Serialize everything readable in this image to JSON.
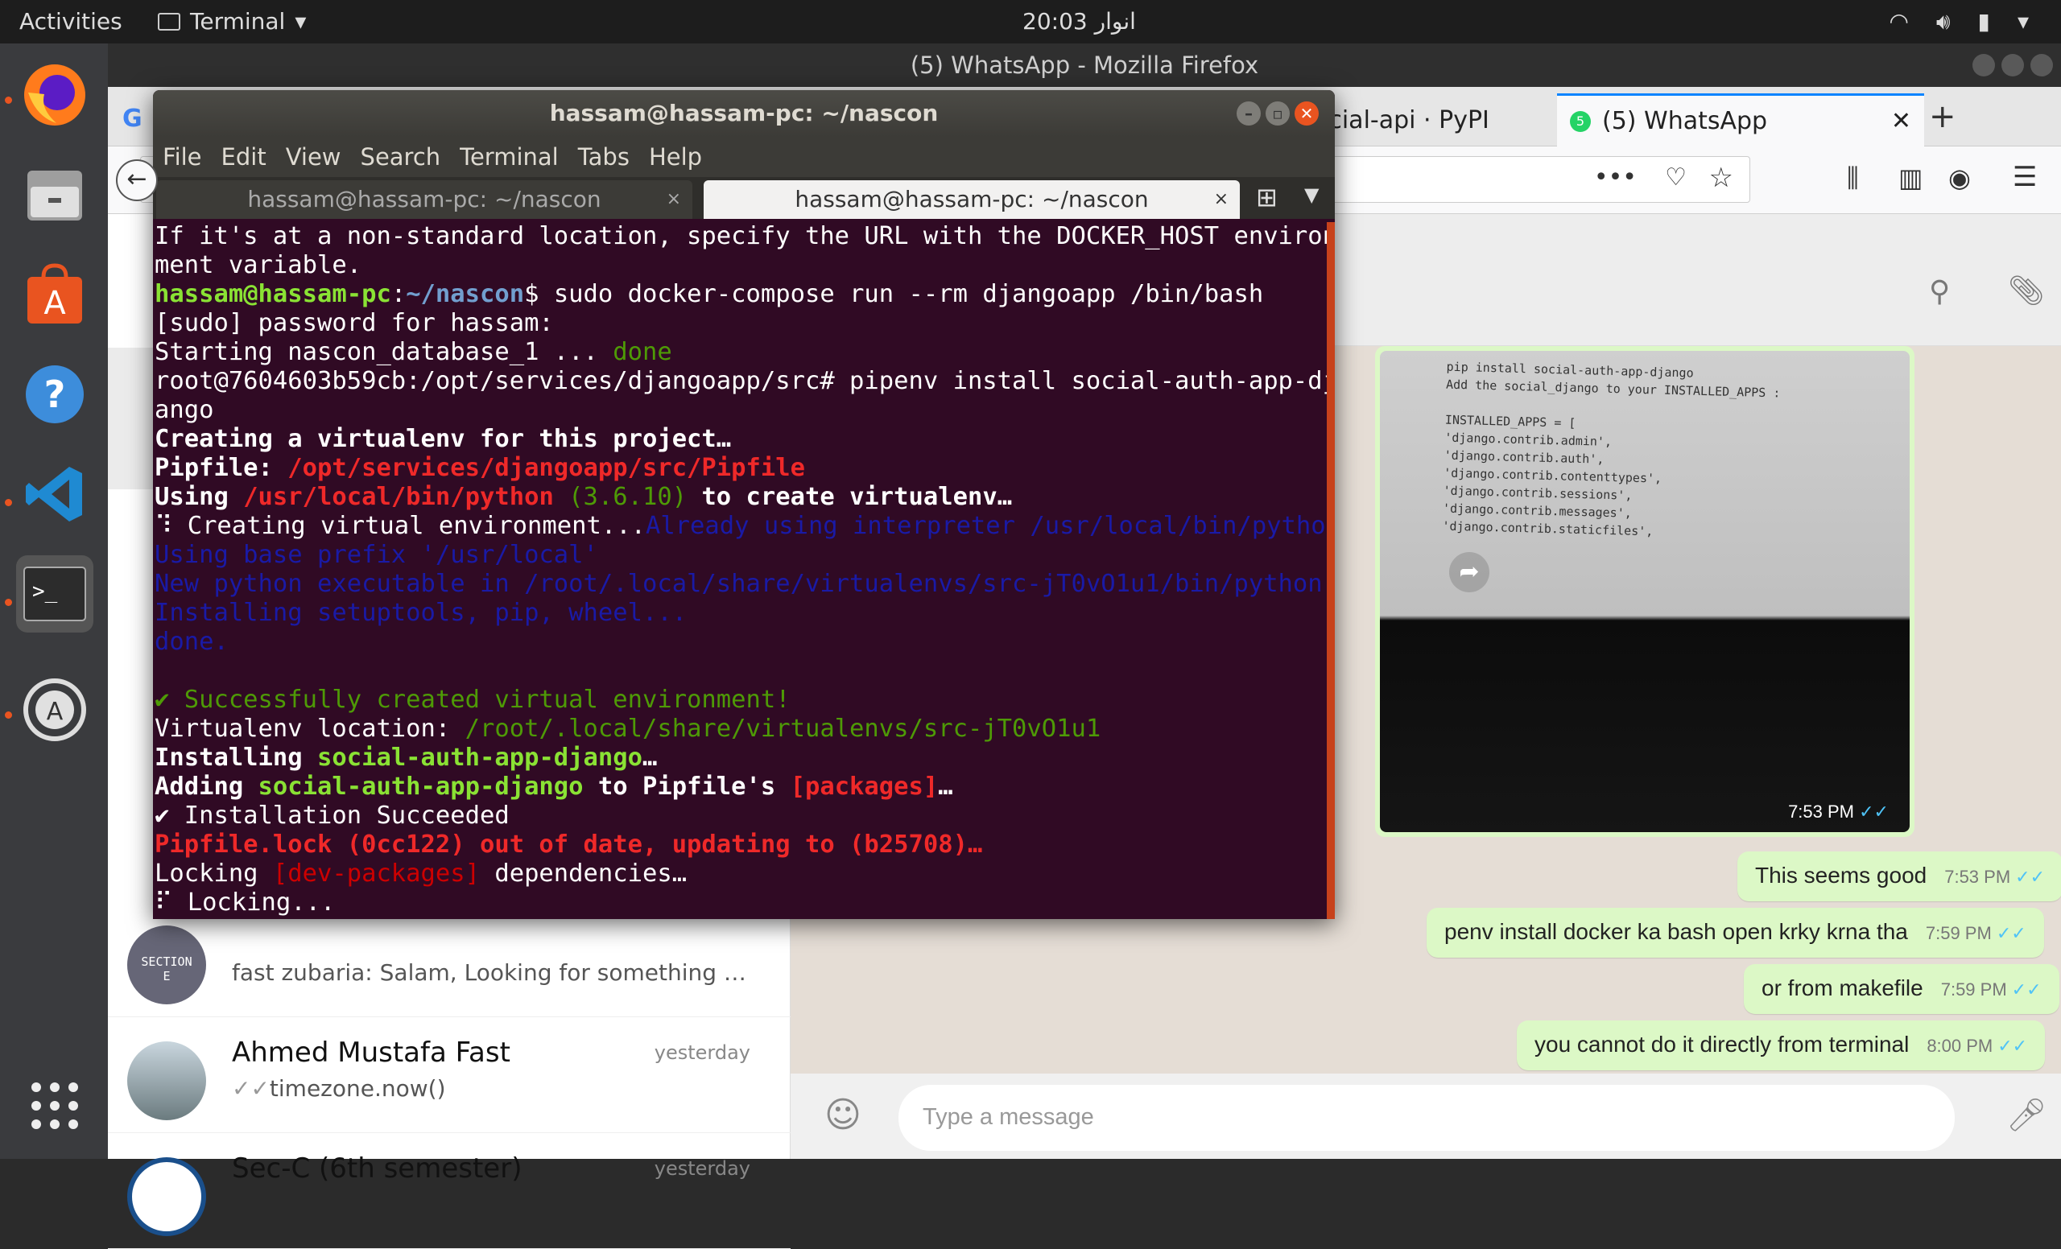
{
  "topbar": {
    "activities": "Activities",
    "app": "Terminal",
    "clock": "20:03 انوار"
  },
  "firefox": {
    "window_title": "(5) WhatsApp - Mozilla Firefox",
    "tabs": [
      {
        "label": "ocial-api · PyPI"
      },
      {
        "label": "(5) WhatsApp",
        "badge": "5"
      }
    ]
  },
  "whatsapp": {
    "chats": [
      {
        "name": "SECTION E",
        "time": "",
        "msg": "fast zubaria: Salam, Looking for something to do..."
      },
      {
        "name": "Ahmed Mustafa Fast",
        "time": "yesterday",
        "msg": "timezone.now()"
      },
      {
        "name": "Sec-C (6th semester)",
        "time": "yesterday",
        "msg": ""
      }
    ],
    "photo": {
      "time": "7:53 PM",
      "lines": [
        "pip install social-auth-app-django",
        "",
        "Add the  social_django  to your  INSTALLED_APPS :",
        "",
        "INSTALLED_APPS = [",
        "    'django.contrib.admin',",
        "    'django.contrib.auth',",
        "    'django.contrib.contenttypes',",
        "    'django.contrib.sessions',",
        "    'django.contrib.messages',",
        "    'django.contrib.staticfiles',"
      ]
    },
    "messages": [
      {
        "text": "This seems good",
        "time": "7:53 PM"
      },
      {
        "text": "penv install docker ka bash open krky krna tha",
        "time": "7:59 PM"
      },
      {
        "text": "or from makefile",
        "time": "7:59 PM"
      },
      {
        "text": "you cannot do it directly from terminal",
        "time": "8:00 PM"
      }
    ],
    "composer_placeholder": "Type a message"
  },
  "terminal": {
    "title": "hassam@hassam-pc: ~/nascon",
    "menu": [
      "File",
      "Edit",
      "View",
      "Search",
      "Terminal",
      "Tabs",
      "Help"
    ],
    "tabs": [
      "hassam@hassam-pc: ~/nascon",
      "hassam@hassam-pc: ~/nascon"
    ]
  },
  "colors": {
    "terminal_bg": "#300a24",
    "bubble": "#dcf8c6",
    "ubuntu_orange": "#e95420",
    "chat_bg": "#e5ddd5"
  }
}
